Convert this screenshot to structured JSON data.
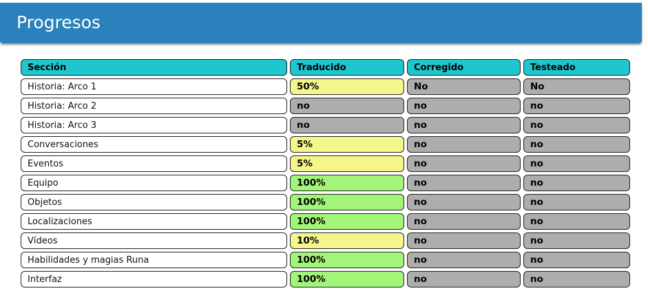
{
  "header": {
    "title": "Progresos"
  },
  "colors": {
    "header_bg": "#2b81bc",
    "column_header_bg": "#1ec6cf",
    "partial": "#f4f58a",
    "complete": "#a3f57a",
    "none": "#adadad"
  },
  "table": {
    "columns": [
      "Sección",
      "Traducido",
      "Corregido",
      "Testeado"
    ],
    "rows": [
      {
        "section": "Historia: Arco 1",
        "traducido": "50%",
        "corregido": "No",
        "testeado": "No",
        "status": "partial"
      },
      {
        "section": "Historia: Arco 2",
        "traducido": "no",
        "corregido": "no",
        "testeado": "no",
        "status": "none"
      },
      {
        "section": "Historia: Arco 3",
        "traducido": "no",
        "corregido": "no",
        "testeado": "no",
        "status": "none"
      },
      {
        "section": "Conversaciones",
        "traducido": "5%",
        "corregido": "no",
        "testeado": "no",
        "status": "partial"
      },
      {
        "section": "Eventos",
        "traducido": "5%",
        "corregido": "no",
        "testeado": "no",
        "status": "partial"
      },
      {
        "section": "Equipo",
        "traducido": "100%",
        "corregido": "no",
        "testeado": "no",
        "status": "done"
      },
      {
        "section": "Objetos",
        "traducido": "100%",
        "corregido": "no",
        "testeado": "no",
        "status": "done"
      },
      {
        "section": "Localizaciones",
        "traducido": "100%",
        "corregido": "no",
        "testeado": "no",
        "status": "done"
      },
      {
        "section": "Vídeos",
        "traducido": "10%",
        "corregido": "no",
        "testeado": "no",
        "status": "partial"
      },
      {
        "section": "Habilidades y magias Runa",
        "traducido": "100%",
        "corregido": "no",
        "testeado": "no",
        "status": "done"
      },
      {
        "section": "Interfaz",
        "traducido": "100%",
        "corregido": "no",
        "testeado": "no",
        "status": "done"
      }
    ]
  }
}
